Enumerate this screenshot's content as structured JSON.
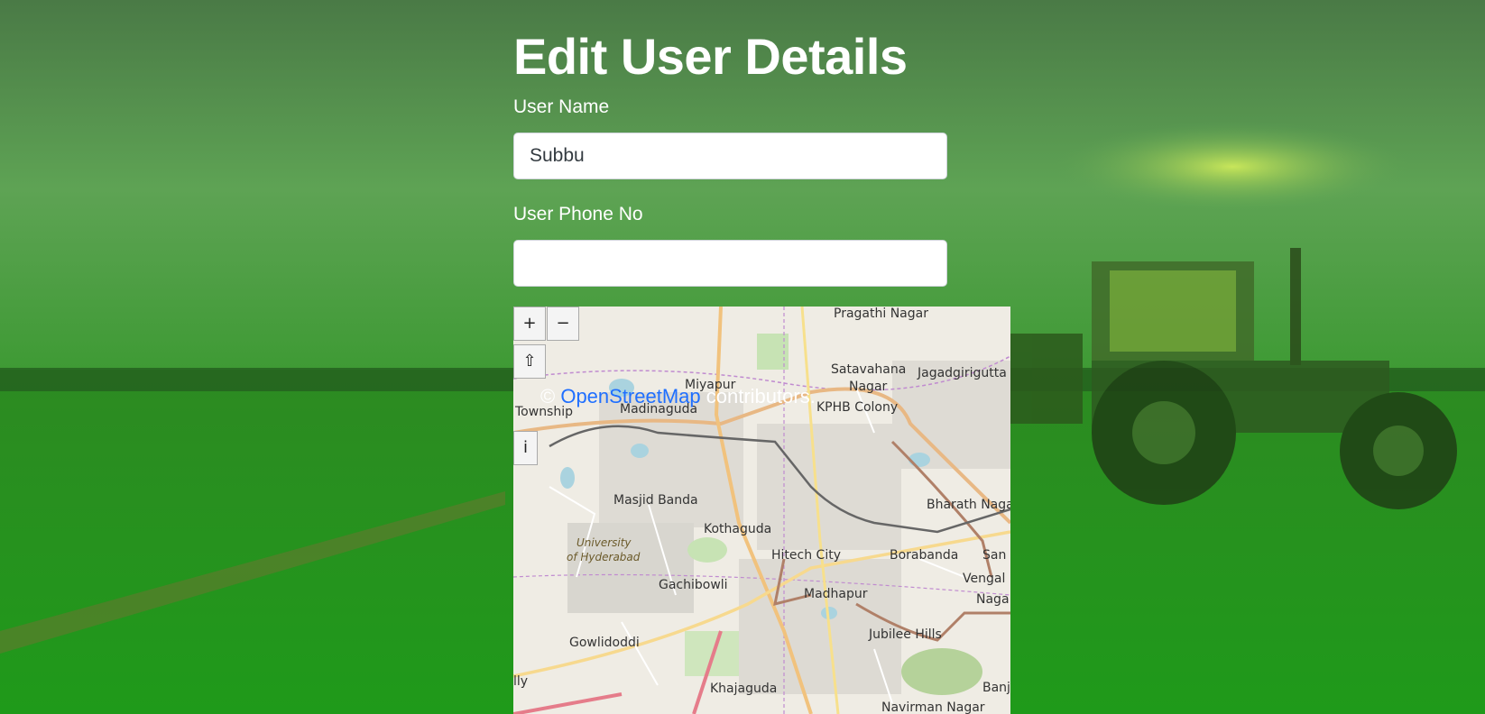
{
  "form": {
    "title": "Edit User Details",
    "name_label": "User Name",
    "name_value": "Subbu",
    "phone_label": "User Phone No",
    "phone_value": ""
  },
  "map": {
    "zoom_in": "+",
    "zoom_out": "−",
    "reset_rotation": "⇧",
    "info": "i",
    "attribution_prefix": "© ",
    "attribution_link": "OpenStreetMap",
    "attribution_suffix": " contributors.",
    "places": [
      "Pragathi Nagar",
      "Satavahana",
      "Nagar",
      "Jagadgirigutta",
      "Miyapur",
      "Township",
      "Madinaguda",
      "KPHB Colony",
      "Masjid Banda",
      "Bharath Naga",
      "Kothaguda",
      "University",
      "of Hyderabad",
      "Hitech City",
      "Borabanda",
      "San",
      "Vengal",
      "Naga",
      "Gachibowli",
      "Madhapur",
      "Gowlidoddi",
      "Jubilee Hills",
      "lly",
      "Khajaguda",
      "Banja",
      "Navirman Nagar"
    ]
  },
  "colors": {
    "background_green": "#2f8f2a",
    "title_text": "#ffffff",
    "link_blue": "#1f6fff"
  }
}
